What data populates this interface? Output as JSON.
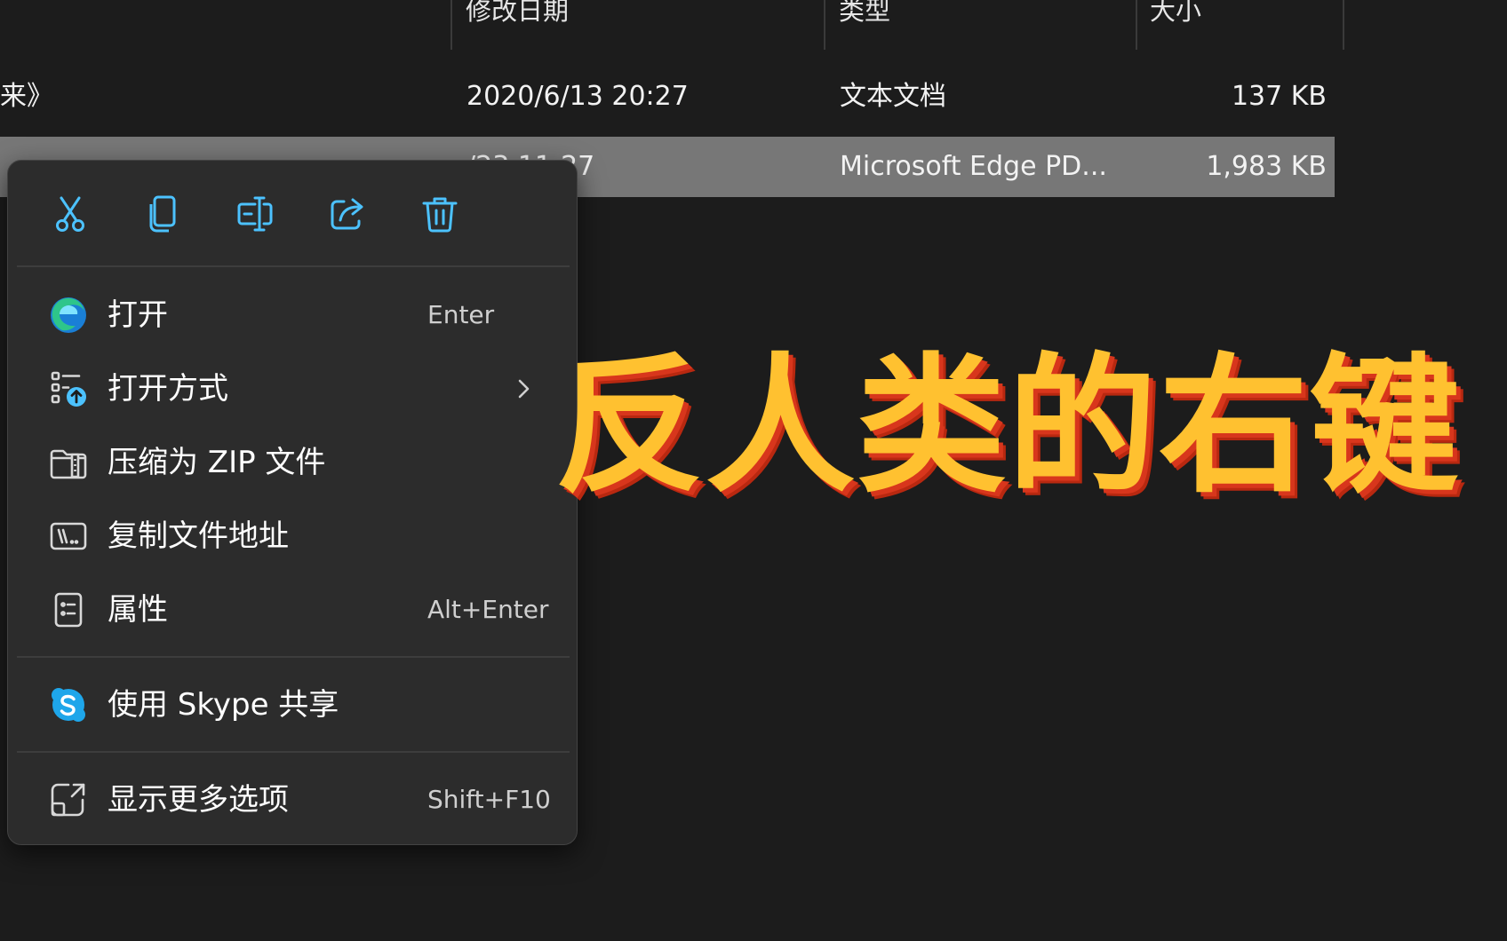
{
  "explorer": {
    "columns": {
      "date": "修改日期",
      "type": "类型",
      "size": "大小"
    },
    "rows": [
      {
        "name": "来》",
        "date": "2020/6/13 20:27",
        "type": "文本文档",
        "size": "137 KB",
        "selected": false
      },
      {
        "name": "",
        "date": "/23 11:27",
        "type": "Microsoft Edge PD...",
        "size": "1,983 KB",
        "selected": true
      }
    ]
  },
  "context_menu": {
    "quick_actions": [
      {
        "icon": "cut-icon"
      },
      {
        "icon": "copy-icon"
      },
      {
        "icon": "rename-icon"
      },
      {
        "icon": "share-icon"
      },
      {
        "icon": "delete-icon"
      }
    ],
    "items": [
      {
        "icon": "edge-icon",
        "label": "打开",
        "shortcut": "Enter"
      },
      {
        "icon": "open-with-icon",
        "label": "打开方式",
        "has_submenu": true
      },
      {
        "icon": "zip-folder-icon",
        "label": "压缩为 ZIP 文件"
      },
      {
        "icon": "copy-path-icon",
        "label": "复制文件地址"
      },
      {
        "icon": "properties-icon",
        "label": "属性",
        "shortcut": "Alt+Enter"
      },
      {
        "icon": "skype-icon",
        "label": "使用 Skype 共享"
      },
      {
        "icon": "more-options-icon",
        "label": "显示更多选项",
        "shortcut": "Shift+F10"
      }
    ]
  },
  "overlay": {
    "caption": "反人类的右键"
  },
  "colors": {
    "background": "#1c1c1c",
    "menu_background": "#2c2c2c",
    "selected_row": "#777777",
    "accent_icon": "#4cc2ff",
    "caption_fill": "#ffc130",
    "caption_shadow": "#d8361c"
  }
}
